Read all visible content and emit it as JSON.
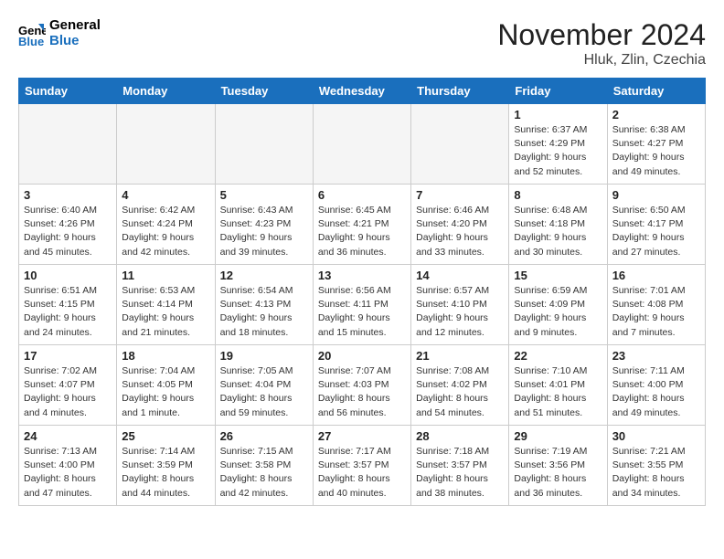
{
  "header": {
    "logo_line1": "General",
    "logo_line2": "Blue",
    "month": "November 2024",
    "location": "Hluk, Zlin, Czechia"
  },
  "weekdays": [
    "Sunday",
    "Monday",
    "Tuesday",
    "Wednesday",
    "Thursday",
    "Friday",
    "Saturday"
  ],
  "weeks": [
    [
      {
        "day": "",
        "info": ""
      },
      {
        "day": "",
        "info": ""
      },
      {
        "day": "",
        "info": ""
      },
      {
        "day": "",
        "info": ""
      },
      {
        "day": "",
        "info": ""
      },
      {
        "day": "1",
        "info": "Sunrise: 6:37 AM\nSunset: 4:29 PM\nDaylight: 9 hours\nand 52 minutes."
      },
      {
        "day": "2",
        "info": "Sunrise: 6:38 AM\nSunset: 4:27 PM\nDaylight: 9 hours\nand 49 minutes."
      }
    ],
    [
      {
        "day": "3",
        "info": "Sunrise: 6:40 AM\nSunset: 4:26 PM\nDaylight: 9 hours\nand 45 minutes."
      },
      {
        "day": "4",
        "info": "Sunrise: 6:42 AM\nSunset: 4:24 PM\nDaylight: 9 hours\nand 42 minutes."
      },
      {
        "day": "5",
        "info": "Sunrise: 6:43 AM\nSunset: 4:23 PM\nDaylight: 9 hours\nand 39 minutes."
      },
      {
        "day": "6",
        "info": "Sunrise: 6:45 AM\nSunset: 4:21 PM\nDaylight: 9 hours\nand 36 minutes."
      },
      {
        "day": "7",
        "info": "Sunrise: 6:46 AM\nSunset: 4:20 PM\nDaylight: 9 hours\nand 33 minutes."
      },
      {
        "day": "8",
        "info": "Sunrise: 6:48 AM\nSunset: 4:18 PM\nDaylight: 9 hours\nand 30 minutes."
      },
      {
        "day": "9",
        "info": "Sunrise: 6:50 AM\nSunset: 4:17 PM\nDaylight: 9 hours\nand 27 minutes."
      }
    ],
    [
      {
        "day": "10",
        "info": "Sunrise: 6:51 AM\nSunset: 4:15 PM\nDaylight: 9 hours\nand 24 minutes."
      },
      {
        "day": "11",
        "info": "Sunrise: 6:53 AM\nSunset: 4:14 PM\nDaylight: 9 hours\nand 21 minutes."
      },
      {
        "day": "12",
        "info": "Sunrise: 6:54 AM\nSunset: 4:13 PM\nDaylight: 9 hours\nand 18 minutes."
      },
      {
        "day": "13",
        "info": "Sunrise: 6:56 AM\nSunset: 4:11 PM\nDaylight: 9 hours\nand 15 minutes."
      },
      {
        "day": "14",
        "info": "Sunrise: 6:57 AM\nSunset: 4:10 PM\nDaylight: 9 hours\nand 12 minutes."
      },
      {
        "day": "15",
        "info": "Sunrise: 6:59 AM\nSunset: 4:09 PM\nDaylight: 9 hours\nand 9 minutes."
      },
      {
        "day": "16",
        "info": "Sunrise: 7:01 AM\nSunset: 4:08 PM\nDaylight: 9 hours\nand 7 minutes."
      }
    ],
    [
      {
        "day": "17",
        "info": "Sunrise: 7:02 AM\nSunset: 4:07 PM\nDaylight: 9 hours\nand 4 minutes."
      },
      {
        "day": "18",
        "info": "Sunrise: 7:04 AM\nSunset: 4:05 PM\nDaylight: 9 hours\nand 1 minute."
      },
      {
        "day": "19",
        "info": "Sunrise: 7:05 AM\nSunset: 4:04 PM\nDaylight: 8 hours\nand 59 minutes."
      },
      {
        "day": "20",
        "info": "Sunrise: 7:07 AM\nSunset: 4:03 PM\nDaylight: 8 hours\nand 56 minutes."
      },
      {
        "day": "21",
        "info": "Sunrise: 7:08 AM\nSunset: 4:02 PM\nDaylight: 8 hours\nand 54 minutes."
      },
      {
        "day": "22",
        "info": "Sunrise: 7:10 AM\nSunset: 4:01 PM\nDaylight: 8 hours\nand 51 minutes."
      },
      {
        "day": "23",
        "info": "Sunrise: 7:11 AM\nSunset: 4:00 PM\nDaylight: 8 hours\nand 49 minutes."
      }
    ],
    [
      {
        "day": "24",
        "info": "Sunrise: 7:13 AM\nSunset: 4:00 PM\nDaylight: 8 hours\nand 47 minutes."
      },
      {
        "day": "25",
        "info": "Sunrise: 7:14 AM\nSunset: 3:59 PM\nDaylight: 8 hours\nand 44 minutes."
      },
      {
        "day": "26",
        "info": "Sunrise: 7:15 AM\nSunset: 3:58 PM\nDaylight: 8 hours\nand 42 minutes."
      },
      {
        "day": "27",
        "info": "Sunrise: 7:17 AM\nSunset: 3:57 PM\nDaylight: 8 hours\nand 40 minutes."
      },
      {
        "day": "28",
        "info": "Sunrise: 7:18 AM\nSunset: 3:57 PM\nDaylight: 8 hours\nand 38 minutes."
      },
      {
        "day": "29",
        "info": "Sunrise: 7:19 AM\nSunset: 3:56 PM\nDaylight: 8 hours\nand 36 minutes."
      },
      {
        "day": "30",
        "info": "Sunrise: 7:21 AM\nSunset: 3:55 PM\nDaylight: 8 hours\nand 34 minutes."
      }
    ]
  ]
}
